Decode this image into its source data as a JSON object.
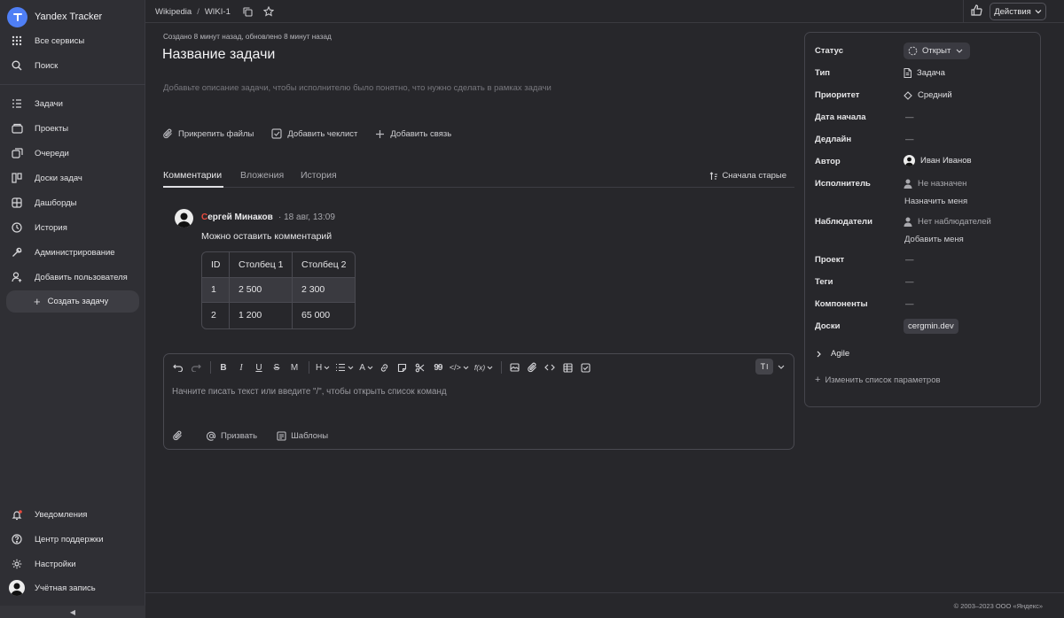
{
  "app": {
    "title": "Yandex Tracker",
    "accent": "#4f7ff5"
  },
  "sidebar": {
    "top_items": [
      {
        "label": "Все сервисы",
        "icon": "grid-icon"
      },
      {
        "label": "Поиск",
        "icon": "search-icon"
      }
    ],
    "items": [
      {
        "label": "Задачи",
        "icon": "tasks-icon"
      },
      {
        "label": "Проекты",
        "icon": "projects-icon"
      },
      {
        "label": "Очереди",
        "icon": "queues-icon"
      },
      {
        "label": "Доски задач",
        "icon": "boards-icon"
      },
      {
        "label": "Дашборды",
        "icon": "dashboards-icon"
      },
      {
        "label": "История",
        "icon": "history-icon"
      },
      {
        "label": "Администрирование",
        "icon": "admin-icon"
      },
      {
        "label": "Добавить пользователя",
        "icon": "add-user-icon"
      }
    ],
    "create_task": "Создать задачу",
    "bottom_items": [
      {
        "label": "Уведомления",
        "icon": "bell-icon"
      },
      {
        "label": "Центр поддержки",
        "icon": "help-icon"
      },
      {
        "label": "Настройки",
        "icon": "gear-icon"
      },
      {
        "label": "Учётная запись",
        "icon": "avatar"
      }
    ],
    "collapse_glyph": "◀"
  },
  "topbar": {
    "breadcrumb": [
      "Wikipedia",
      "WIKI-1"
    ],
    "separator": "/",
    "actions_label": "Действия"
  },
  "task": {
    "meta": "Создано 8 минут назад, обновлено 8 минут назад",
    "title": "Название задачи",
    "description_placeholder": "Добавьте описание задачи, чтобы исполнителю было понятно, что нужно сделать в рамках задачи",
    "actions": [
      "Прикрепить файлы",
      "Добавить чеклист",
      "Добавить связь"
    ]
  },
  "tabs": {
    "items": [
      "Комментарии",
      "Вложения",
      "История"
    ],
    "active": 0,
    "sort_label": "Сначала старые"
  },
  "comment": {
    "author_first_letter": "С",
    "author_rest": "ергей Минаков",
    "date": "· 18 авг, 13:09",
    "text": "Можно оставить комментарий",
    "table": {
      "headers": [
        "ID",
        "Столбец 1",
        "Столбец 2"
      ],
      "rows": [
        [
          "1",
          "2 500",
          "2 300"
        ],
        [
          "2",
          "1 200",
          "65 000"
        ]
      ]
    }
  },
  "editor": {
    "placeholder": "Начните писать текст или введите \"/\", чтобы открыть список команд",
    "format_toggle": "T",
    "mention_label": "Призвать",
    "templates_label": "Шаблоны",
    "toolbar_glyphs": {
      "bold": "B",
      "italic": "I",
      "underline": "U",
      "strike": "S",
      "mono": "M",
      "heading": "H",
      "color": "A",
      "quote": "99",
      "code": "</>",
      "formula": "f(x)"
    }
  },
  "fields": {
    "status": {
      "label": "Статус",
      "value": "Открыт"
    },
    "type": {
      "label": "Тип",
      "value": "Задача"
    },
    "priority": {
      "label": "Приоритет",
      "value": "Средний"
    },
    "start_date": {
      "label": "Дата начала",
      "value": "—"
    },
    "deadline": {
      "label": "Дедлайн",
      "value": "—"
    },
    "author": {
      "label": "Автор",
      "value": "Иван Иванов"
    },
    "assignee": {
      "label": "Исполнитель",
      "value": "Не назначен",
      "link": "Назначить меня"
    },
    "watchers": {
      "label": "Наблюдатели",
      "value": "Нет наблюдателей",
      "link": "Добавить меня"
    },
    "project": {
      "label": "Проект",
      "value": "—"
    },
    "tags": {
      "label": "Теги",
      "value": "—"
    },
    "components": {
      "label": "Компоненты",
      "value": "—"
    },
    "boards": {
      "label": "Доски",
      "value": "cergmin.dev"
    },
    "agile": "Agile",
    "change_params": "Изменить список параметров"
  },
  "footer": {
    "copyright": "© 2003–2023 ООО «Яндекс»"
  }
}
